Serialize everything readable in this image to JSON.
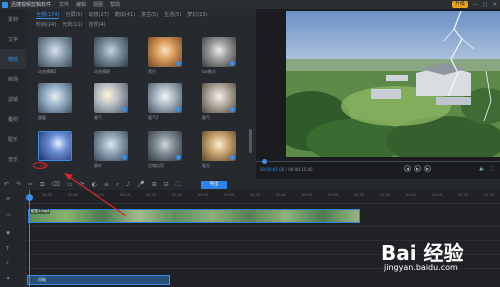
{
  "titlebar": {
    "title": "迅捷视频剪辑软件",
    "menu": [
      "文件",
      "编辑",
      "视图",
      "帮助"
    ],
    "upgrade": "升级",
    "controls": [
      "—",
      "□",
      "✕"
    ]
  },
  "leftnav": {
    "items": [
      "素材",
      "文字",
      "特效",
      "转场",
      "滤镜",
      "叠附",
      "配乐",
      "音乐"
    ],
    "active_index": 2
  },
  "library": {
    "tabs": [
      "全部(174)",
      "分屏(5)",
      "动感(27)",
      "酷炫(41)",
      "复古(5)",
      "生活(5)",
      "梦幻(23)"
    ],
    "tabs2": [
      "时尚(24)",
      "光效(11)",
      "自然(4)"
    ],
    "thumbs": [
      {
        "label": "动态模糊2"
      },
      {
        "label": "动态模糊"
      },
      {
        "label": "黑白"
      },
      {
        "label": "bw模式"
      },
      {
        "label": "晨露"
      },
      {
        "label": "暖气"
      },
      {
        "label": "暖气2"
      },
      {
        "label": "暖气"
      },
      {
        "label": "闪电"
      },
      {
        "label": "飘叶"
      },
      {
        "label": "灵魂出窍"
      },
      {
        "label": "暖光"
      }
    ]
  },
  "preview": {
    "current_time": "00:00:01.00",
    "total_time": "00:00:15.00",
    "timecode_sep": "/",
    "controls": [
      "◀",
      "▶",
      "▶"
    ]
  },
  "toolbar": {
    "icons": [
      "↶",
      "↷",
      "✂",
      "⧉",
      "⌫",
      "▭",
      "⟳",
      "◐",
      "≡",
      "⌕",
      "♪",
      "🎤",
      "⊞",
      "⊟",
      "⛶"
    ],
    "export_label": "导出"
  },
  "timeline": {
    "ticks": [
      "00:00",
      "00:05",
      "00:10",
      "00:15",
      "00:20",
      "00:25",
      "00:30",
      "00:35",
      "00:40",
      "00:45",
      "00:50",
      "00:55",
      "01:00",
      "01:05",
      "01:10",
      "01:15",
      "01:20",
      "01:25"
    ],
    "track_icons": [
      "▭",
      "◉",
      "T",
      "♪",
      "✦"
    ],
    "video_clip_label": "航拍1.mp4",
    "effect_clip_label": "闪电"
  },
  "watermark": {
    "main": "Bai 经验",
    "sub": "jingyan.baidu.com"
  },
  "colors": {
    "accent": "#3a8ee6",
    "upgrade": "#e8a51a",
    "annotation_red": "#d8262b"
  }
}
